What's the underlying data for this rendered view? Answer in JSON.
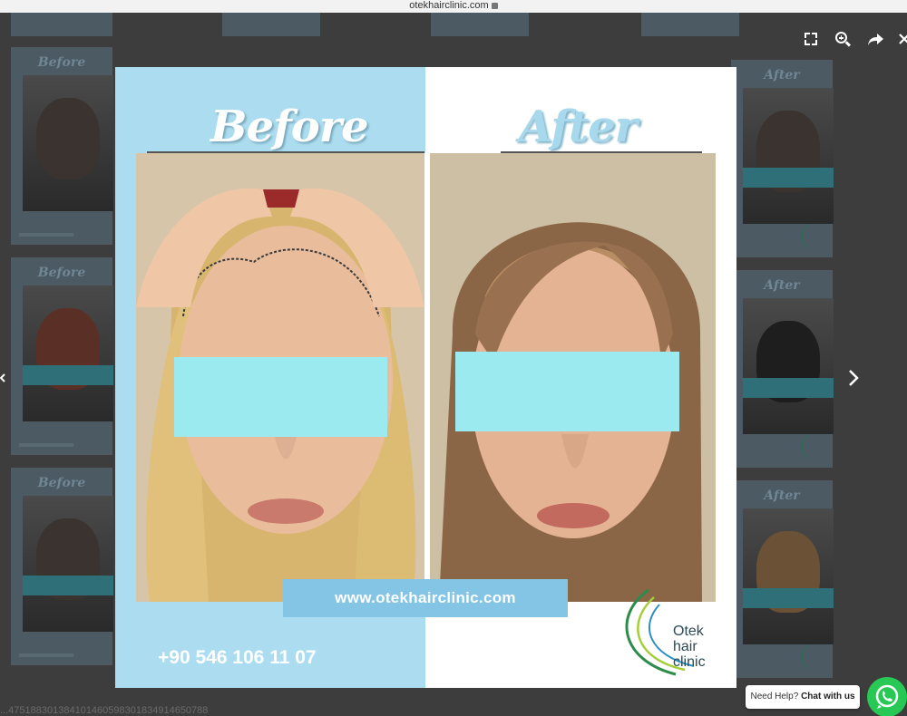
{
  "browser": {
    "url": "otekhairclinic.com"
  },
  "gallery": {
    "thumb_labels": [
      "Before",
      "After",
      "Before",
      "After",
      "Before",
      "After"
    ]
  },
  "lightbox": {
    "before_title": "Before",
    "after_title": "After",
    "website": "www.otekhairclinic.com",
    "phone": "+90 546 106 11 07",
    "logo_lines": [
      "Otek",
      "hair",
      "clinic"
    ]
  },
  "colors": {
    "left_panel": "#abdcef",
    "eye_mask": "#9aeaf0",
    "url_banner": "#84c4e4",
    "whatsapp": "#27c954"
  },
  "icons": {
    "toolbar": [
      "fullscreen-icon",
      "zoom-in-icon",
      "share-icon",
      "close-icon"
    ],
    "nav": [
      "chevron-right-icon",
      "chevron-left-icon"
    ],
    "chat": "whatsapp-icon"
  },
  "chat": {
    "help_prefix": "Need Help?",
    "help_action": "Chat with us"
  },
  "footer": {
    "digits": "...475188301384101460598301834914650788"
  }
}
